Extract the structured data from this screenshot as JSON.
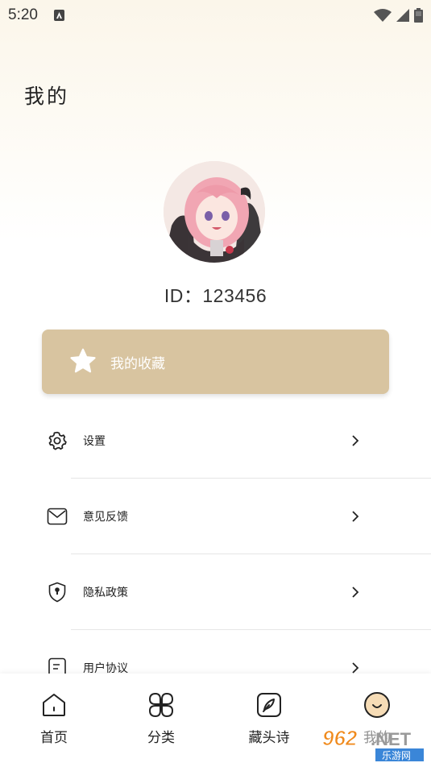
{
  "status_bar": {
    "time": "5:20"
  },
  "header": {
    "title": "我的"
  },
  "profile": {
    "id_text": "ID：123456"
  },
  "favorites": {
    "label": "我的收藏"
  },
  "menu": [
    {
      "label": "设置",
      "icon": "gear-icon"
    },
    {
      "label": "意见反馈",
      "icon": "mail-icon"
    },
    {
      "label": "隐私政策",
      "icon": "shield-icon"
    },
    {
      "label": "用户协议",
      "icon": "document-icon"
    }
  ],
  "tabs": [
    {
      "label": "首页",
      "icon": "home-icon"
    },
    {
      "label": "分类",
      "icon": "grid-icon"
    },
    {
      "label": "藏头诗",
      "icon": "feather-icon"
    },
    {
      "label": "我的",
      "icon": "smiley-icon"
    }
  ],
  "watermark": {
    "text_top": "962.NET",
    "text_bottom": "乐游网"
  },
  "colors": {
    "accent_card": "#d8c4a0",
    "background_top": "#fbf6ea"
  }
}
